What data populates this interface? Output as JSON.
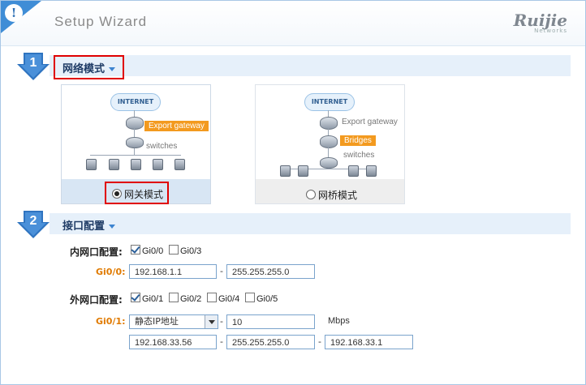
{
  "header": {
    "title": "Setup Wizard",
    "logo_text": "Ruijie",
    "logo_sub": "Networks"
  },
  "section1": {
    "number": "1",
    "title": "网络模式",
    "gateway_card": {
      "label": "网关模式",
      "selected": true,
      "cloud_label": "INTERNET",
      "tag_export": "Export gateway",
      "text_switches": "switches"
    },
    "bridge_card": {
      "label": "网桥模式",
      "selected": false,
      "cloud_label": "INTERNET",
      "text_export": "Export gateway",
      "tag_bridges": "Bridges",
      "text_switches": "switches"
    }
  },
  "section2": {
    "number": "2",
    "title": "接口配置",
    "lan": {
      "label": "内网口配置:",
      "ports": [
        {
          "name": "Gi0/0",
          "checked": true
        },
        {
          "name": "Gi0/3",
          "checked": false
        }
      ],
      "iface_label": "Gi0/0:",
      "ip": "192.168.1.1",
      "mask": "255.255.255.0"
    },
    "wan": {
      "label": "外网口配置:",
      "ports": [
        {
          "name": "Gi0/1",
          "checked": true
        },
        {
          "name": "Gi0/2",
          "checked": false
        },
        {
          "name": "Gi0/4",
          "checked": false
        },
        {
          "name": "Gi0/5",
          "checked": false
        }
      ],
      "iface_label": "Gi0/1:",
      "mode": "静态IP地址",
      "bandwidth": "10",
      "bandwidth_unit": "Mbps",
      "ip": "192.168.33.56",
      "mask": "255.255.255.0",
      "gateway": "192.168.33.1"
    }
  },
  "colors": {
    "accent": "#3d84d0",
    "highlight_red": "#e00000",
    "orange": "#f39a1f"
  }
}
